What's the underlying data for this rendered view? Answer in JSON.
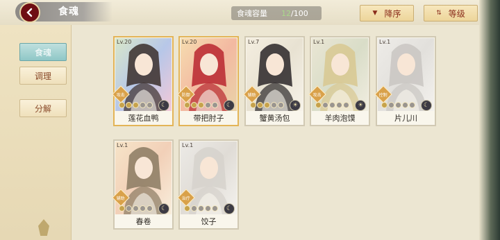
{
  "header": {
    "title": "食魂",
    "capacity_label": "食魂容量",
    "capacity_current": "12",
    "capacity_max": "/100",
    "sort_label": "降序",
    "filter_label": "等级"
  },
  "sidebar": {
    "items": [
      {
        "label": "食魂",
        "active": true
      },
      {
        "label": "调理",
        "active": false
      },
      {
        "label": "分解",
        "active": false
      }
    ]
  },
  "cards": [
    {
      "level": "Lv.20",
      "name": "莲花血鸭",
      "role": "攻击",
      "stars": 3,
      "frame": "gold",
      "element": "moon-icon"
    },
    {
      "level": "Lv.20",
      "name": "带把肘子",
      "role": "防御",
      "stars": 3,
      "frame": "gold",
      "element": "moon-icon"
    },
    {
      "level": "Lv.7",
      "name": "蟹黄汤包",
      "role": "辅助",
      "stars": 3,
      "frame": "plain",
      "element": "sun-icon"
    },
    {
      "level": "Lv.1",
      "name": "羊肉泡馍",
      "role": "攻击",
      "stars": 1,
      "frame": "plain",
      "element": "sun-icon"
    },
    {
      "level": "Lv.1",
      "name": "片儿川",
      "role": "控制",
      "stars": 1,
      "frame": "plain",
      "element": "moon-icon"
    },
    {
      "level": "Lv.1",
      "name": "春卷",
      "role": "辅助",
      "stars": 1,
      "frame": "plain",
      "element": "moon-icon"
    },
    {
      "level": "Lv.1",
      "name": "饺子",
      "role": "治疗",
      "stars": 1,
      "frame": "plain",
      "element": "moon-icon"
    }
  ],
  "colors": {
    "accent_red": "#6f0e13",
    "active_tab": "#8fc7c7",
    "gold_frame": "#e3b457"
  }
}
